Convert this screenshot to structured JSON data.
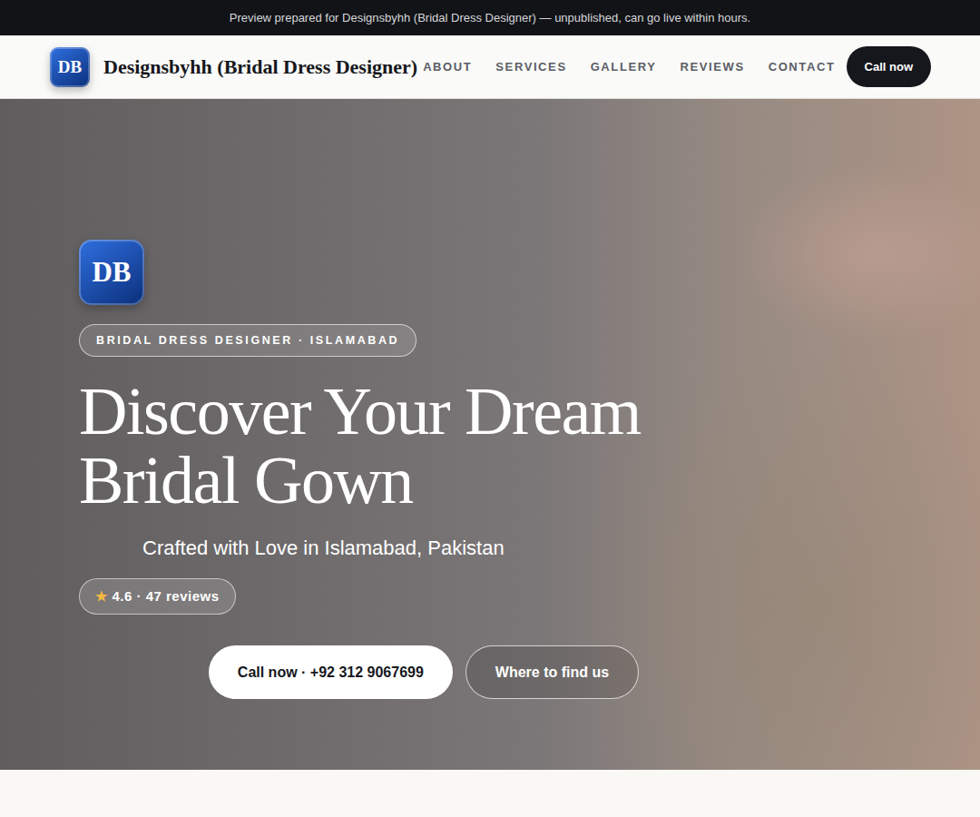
{
  "banner": {
    "text": "Preview prepared for Designsbyhh (Bridal Dress Designer) — unpublished, can go live within hours."
  },
  "header": {
    "logo_initials": "DB",
    "brand": "Designsbyhh (Bridal Dress Designer)",
    "nav": [
      {
        "label": "ABOUT"
      },
      {
        "label": "SERVICES"
      },
      {
        "label": "GALLERY"
      },
      {
        "label": "REVIEWS"
      },
      {
        "label": "CONTACT"
      }
    ],
    "cta": "Call now"
  },
  "hero": {
    "logo_initials": "DB",
    "badge": "BRIDAL DRESS DESIGNER · ISLAMABAD",
    "title": "Discover Your Dream Bridal Gown",
    "subtitle": "Crafted with Love in Islamabad, Pakistan",
    "rating": {
      "star": "★",
      "text": "4.6 · 47 reviews"
    },
    "buttons": [
      {
        "label": "Call now · +92 312 9067699",
        "kind": "primary"
      },
      {
        "label": "Where to find us",
        "kind": "outline"
      }
    ]
  }
}
